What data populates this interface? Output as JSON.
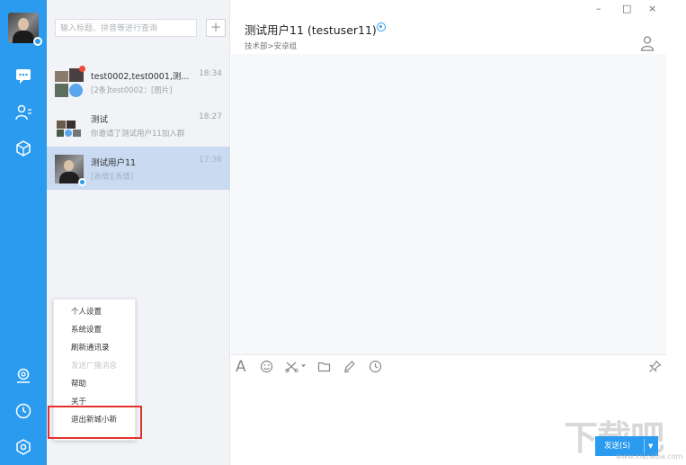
{
  "window": {
    "minimize": "–",
    "maximize": "□",
    "close": "×"
  },
  "search": {
    "placeholder": "输入标题、拼音等进行查询",
    "add_label": "+"
  },
  "conversations": [
    {
      "name": "test0002,test0001,测...",
      "time": "18:34",
      "preview": "[2条]test0002：[图片]",
      "unread": true
    },
    {
      "name": "测试",
      "time": "18:27",
      "preview": "你邀请了测试用户11加入群",
      "unread": false
    },
    {
      "name": "测试用户11",
      "time": "17:36",
      "preview": "[表情][表情]",
      "unread": false,
      "selected": true
    }
  ],
  "menu": {
    "items": [
      {
        "label": "个人设置",
        "disabled": false
      },
      {
        "label": "系统设置",
        "disabled": false
      },
      {
        "label": "刷新通讯录",
        "disabled": false
      },
      {
        "label": "发送广播消息",
        "disabled": true
      },
      {
        "label": "帮助",
        "disabled": false
      },
      {
        "label": "关于",
        "disabled": false
      },
      {
        "label": "退出新城小新",
        "disabled": false
      }
    ]
  },
  "chat": {
    "title": "测试用户11 (testuser11)",
    "subtitle": "技术部>安卓组",
    "send_label": "发送(S)",
    "send_arrow": "▼"
  },
  "toolbar": {
    "font_icon": "A"
  },
  "colors": {
    "accent": "#2a9bef",
    "selected_row": "#c9daf1",
    "highlight": "#e4312b"
  },
  "watermark": {
    "text": "下载吧",
    "url": "www.xiazaiba.com"
  }
}
